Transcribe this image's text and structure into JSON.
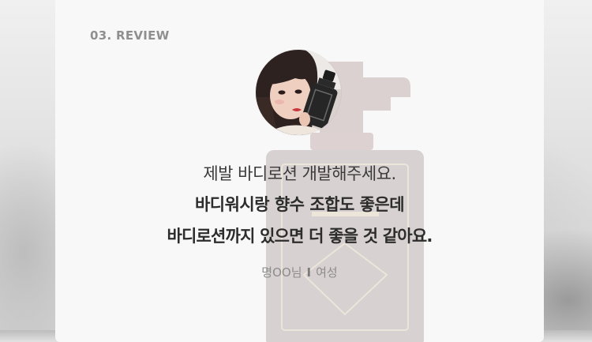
{
  "section": {
    "label": "03. REVIEW"
  },
  "review": {
    "avatar_icon": "reviewer-photo",
    "quote_lines": [
      "제발 바디로션 개발해주세요.",
      "바디워시랑 향수 조합도 좋은데",
      "바디로션까지 있으면 더 좋을 것 같아요."
    ],
    "reviewer_name": "명OO님",
    "separator": "I",
    "reviewer_gender": "여성"
  },
  "colors": {
    "card_background": "#f8f8f8",
    "label": "#8f8f8f",
    "text": "#2c2c2c",
    "meta": "#8c8c8c"
  }
}
